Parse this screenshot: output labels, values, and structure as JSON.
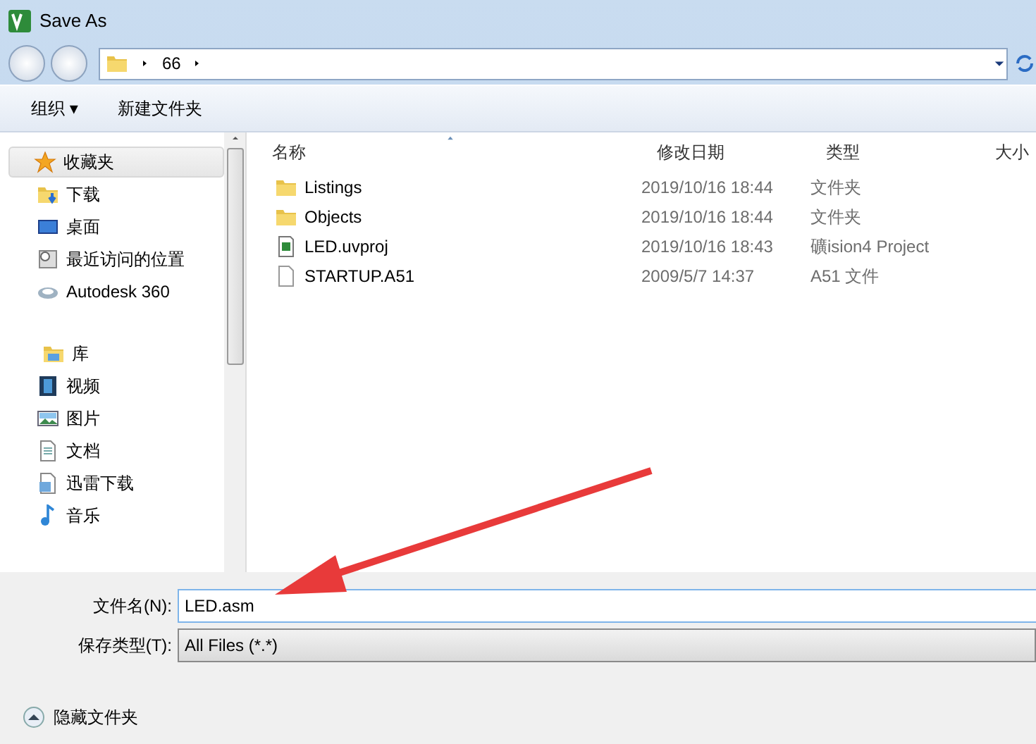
{
  "window": {
    "title": "Save As"
  },
  "address": {
    "segments": [
      "66"
    ]
  },
  "toolbar": {
    "organize": "组织 ▾",
    "new_folder": "新建文件夹"
  },
  "sidebar": {
    "groups": [
      {
        "label": "收藏夹",
        "kind": "favorites",
        "selected": true,
        "children": [
          {
            "label": "下载",
            "kind": "download",
            "selected": false
          },
          {
            "label": "桌面",
            "kind": "desktop",
            "selected": false
          },
          {
            "label": "最近访问的位置",
            "kind": "recent",
            "selected": false
          },
          {
            "label": "Autodesk 360",
            "kind": "cloud",
            "selected": false
          }
        ]
      },
      {
        "label": "库",
        "kind": "library",
        "selected": false,
        "children": [
          {
            "label": "视频",
            "kind": "video",
            "selected": false
          },
          {
            "label": "图片",
            "kind": "pictures",
            "selected": false
          },
          {
            "label": "文档",
            "kind": "documents",
            "selected": false
          },
          {
            "label": "迅雷下载",
            "kind": "documents2",
            "selected": false
          },
          {
            "label": "音乐",
            "kind": "music",
            "selected": false
          }
        ]
      }
    ]
  },
  "table": {
    "columns": [
      "名称",
      "修改日期",
      "类型",
      "大小"
    ],
    "rows": [
      {
        "kind": "folder",
        "name": "Listings",
        "date": "2019/10/16 18:44",
        "type": "文件夹"
      },
      {
        "kind": "folder",
        "name": "Objects",
        "date": "2019/10/16 18:44",
        "type": "文件夹"
      },
      {
        "kind": "project",
        "name": "LED.uvproj",
        "date": "2019/10/16 18:43",
        "type": "礦ision4 Project"
      },
      {
        "kind": "file",
        "name": "STARTUP.A51",
        "date": "2009/5/7 14:37",
        "type": "A51 文件"
      }
    ]
  },
  "form": {
    "filename_label": "文件名(N):",
    "filename": "LED.asm",
    "type_label": "保存类型(T):",
    "type": "All Files (*.*)"
  },
  "footer": {
    "hide_folders": "隐藏文件夹"
  }
}
